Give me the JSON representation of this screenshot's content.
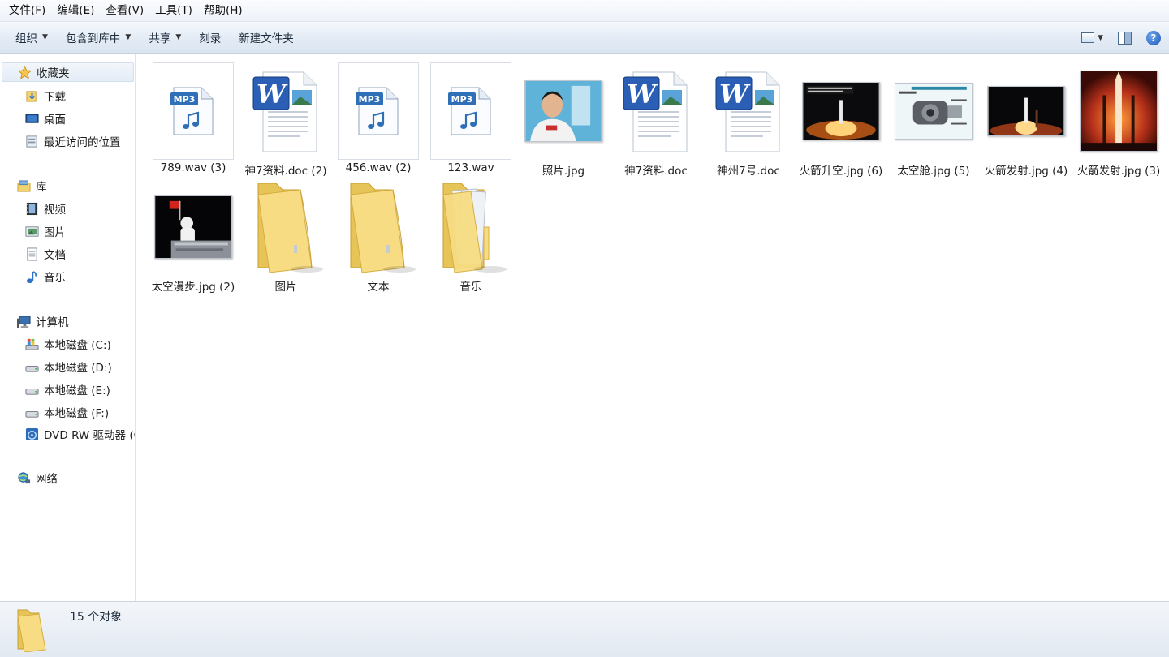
{
  "menu": [
    "文件(F)",
    "编辑(E)",
    "查看(V)",
    "工具(T)",
    "帮助(H)"
  ],
  "toolbar": {
    "organize": "组织",
    "include_library": "包含到库中",
    "share": "共享",
    "burn": "刻录",
    "new_folder": "新建文件夹",
    "help_glyph": "?"
  },
  "nav": {
    "favorites": "收藏夹",
    "downloads": "下载",
    "desktop": "桌面",
    "recent": "最近访问的位置",
    "libraries": "库",
    "videos": "视频",
    "pictures": "图片",
    "documents": "文档",
    "music": "音乐",
    "computer": "计算机",
    "drive_c": "本地磁盘 (C:)",
    "drive_d": "本地磁盘 (D:)",
    "drive_e": "本地磁盘 (E:)",
    "drive_f": "本地磁盘 (F:)",
    "dvd": "DVD RW 驱动器 (G",
    "network": "网络"
  },
  "files": [
    {
      "name": "789.wav (3)",
      "type": "mp3"
    },
    {
      "name": "神7资料.doc (2)",
      "type": "doc"
    },
    {
      "name": "456.wav (2)",
      "type": "mp3"
    },
    {
      "name": "123.wav",
      "type": "mp3"
    },
    {
      "name": "照片.jpg",
      "type": "photo-portrait"
    },
    {
      "name": "神7资料.doc",
      "type": "doc"
    },
    {
      "name": "神州7号.doc",
      "type": "doc"
    },
    {
      "name": "火箭升空.jpg (6)",
      "type": "photo-launch"
    },
    {
      "name": "太空舱.jpg (5)",
      "type": "photo-capsule"
    },
    {
      "name": "火箭发射.jpg (4)",
      "type": "photo-launch-night"
    },
    {
      "name": "火箭发射.jpg (3)",
      "type": "photo-rocket"
    },
    {
      "name": "太空漫步.jpg (2)",
      "type": "photo-spacewalk"
    },
    {
      "name": "图片",
      "type": "folder"
    },
    {
      "name": "文本",
      "type": "folder"
    },
    {
      "name": "音乐",
      "type": "folder-docs"
    }
  ],
  "mp3_badge": "MP3",
  "status": {
    "count_text": "15 个对象"
  },
  "colors": {
    "accent": "#1c58b8",
    "folder": "#f3d36f",
    "word_blue": "#2b5fb5"
  }
}
